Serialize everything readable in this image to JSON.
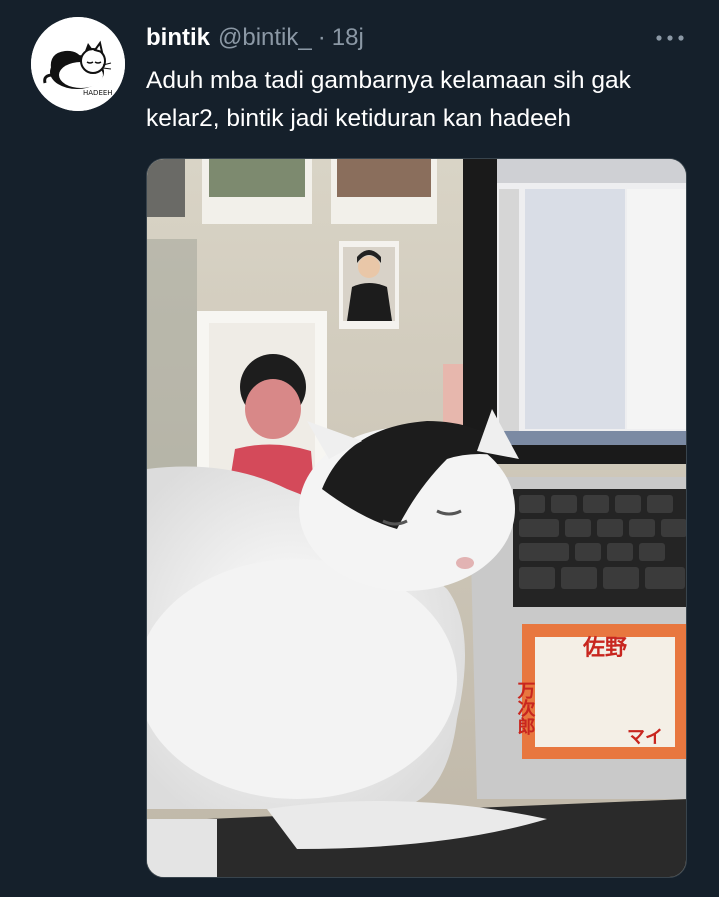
{
  "tweet": {
    "display_name": "bintik",
    "handle": "@bintik_",
    "separator": "·",
    "time": "18j",
    "text": "Aduh mba tadi gambarnya kelamaan sih gak kelar2, bintik jadi ketiduran kan hadeeh",
    "avatar_label": "HADEEH",
    "more_icon": "more-horizontal-icon"
  },
  "photo": {
    "sticker_text_top": "佐野",
    "sticker_text_side": "万次郎",
    "sticker_text_right": "マイ"
  },
  "colors": {
    "background": "#15202b",
    "text_primary": "#ffffff",
    "text_secondary": "#8b98a5"
  }
}
